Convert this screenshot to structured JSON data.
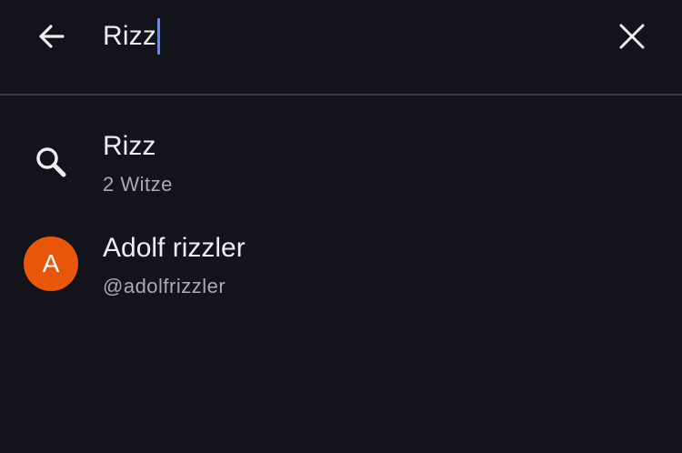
{
  "search": {
    "query": "Rizz",
    "back_icon": "arrow-left-icon",
    "clear_icon": "close-icon"
  },
  "results": [
    {
      "kind": "query-suggestion",
      "icon": "search-icon",
      "title": "Rizz",
      "subtitle": "2 Witze"
    },
    {
      "kind": "user",
      "avatar_letter": "A",
      "avatar_color": "#e8560a",
      "title": "Adolf rizzler",
      "subtitle": "@adolfrizzler"
    }
  ],
  "colors": {
    "background": "#13141b",
    "caret": "#5a8cff",
    "text_primary": "#ececf1",
    "text_secondary": "#a9aab3",
    "divider": "#3a3b43"
  }
}
